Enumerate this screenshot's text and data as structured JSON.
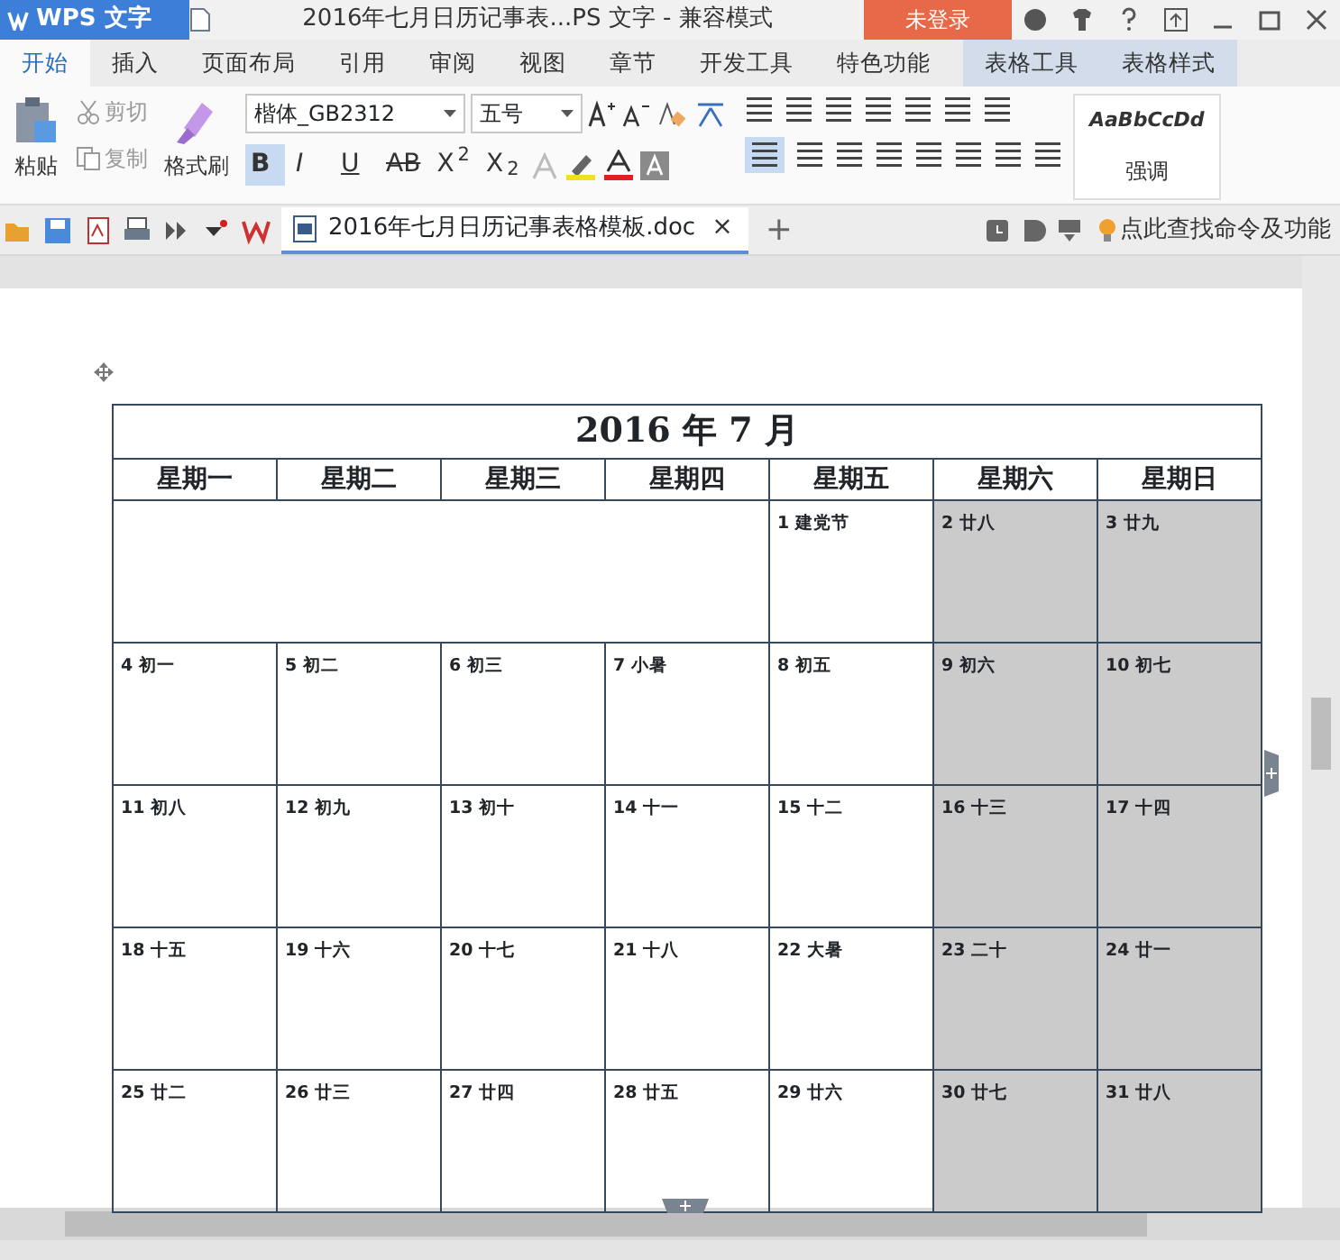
{
  "app_menu": {
    "label": "WPS 文字"
  },
  "window": {
    "title": "2016年七月日历记事表...PS 文字 - 兼容模式"
  },
  "login_button": {
    "label": "未登录"
  },
  "tabs": [
    {
      "label": "开始",
      "selected": true,
      "kind": "main"
    },
    {
      "label": "插入",
      "selected": false,
      "kind": "main"
    },
    {
      "label": "页面布局",
      "selected": false,
      "kind": "main"
    },
    {
      "label": "引用",
      "selected": false,
      "kind": "main"
    },
    {
      "label": "审阅",
      "selected": false,
      "kind": "main"
    },
    {
      "label": "视图",
      "selected": false,
      "kind": "main"
    },
    {
      "label": "章节",
      "selected": false,
      "kind": "main"
    },
    {
      "label": "开发工具",
      "selected": false,
      "kind": "main"
    },
    {
      "label": "特色功能",
      "selected": false,
      "kind": "main"
    },
    {
      "label": "表格工具",
      "selected": false,
      "kind": "context"
    },
    {
      "label": "表格样式",
      "selected": false,
      "kind": "context"
    }
  ],
  "ribbon": {
    "paste": "粘贴",
    "cut": "剪切",
    "copy": "复制",
    "format_painter": "格式刷",
    "font_name": "楷体_GB2312",
    "font_size": "五号",
    "format_buttons": [
      {
        "label": "B",
        "selected": true
      },
      {
        "label": "I",
        "selected": false
      },
      {
        "label": "U",
        "selected": false
      },
      {
        "label": "AB",
        "selected": false
      },
      {
        "label": "X$^{2}$",
        "selected": false
      },
      {
        "label": "X$_{2}$",
        "selected": false
      }
    ],
    "align_left_selected": true,
    "style_preview": "AaBbCcDd",
    "style_name": "强调"
  },
  "document_tab": {
    "label": "2016年七月日历记事表格模板.doc",
    "close": "×",
    "new": "+"
  },
  "command_search": {
    "label": "点此查找命令及功能"
  },
  "calendar": {
    "title": "2016 年 7 月",
    "weekdays": [
      "星期一",
      "星期二",
      "星期三",
      "星期四",
      "星期五",
      "星期六",
      "星期日"
    ],
    "weeks": [
      [
        {
          "kind": "blank"
        },
        {
          "kind": "blank"
        },
        {
          "kind": "blank"
        },
        {
          "kind": "blank"
        },
        {
          "kind": "day",
          "date": "1",
          "note": "建党节",
          "shaded": false
        },
        {
          "kind": "day",
          "date": "2",
          "note": "廿八",
          "shaded": true
        },
        {
          "kind": "day",
          "date": "3",
          "note": "廿九",
          "shaded": true
        }
      ],
      [
        {
          "kind": "day",
          "date": "4",
          "note": "初一",
          "shaded": false
        },
        {
          "kind": "day",
          "date": "5",
          "note": "初二",
          "shaded": false
        },
        {
          "kind": "day",
          "date": "6",
          "note": "初三",
          "shaded": false
        },
        {
          "kind": "day",
          "date": "7",
          "note": "小暑",
          "shaded": false
        },
        {
          "kind": "day",
          "date": "8",
          "note": "初五",
          "shaded": false
        },
        {
          "kind": "day",
          "date": "9",
          "note": "初六",
          "shaded": true
        },
        {
          "kind": "day",
          "date": "10",
          "note": "初七",
          "shaded": true
        }
      ],
      [
        {
          "kind": "day",
          "date": "11",
          "note": "初八",
          "shaded": false
        },
        {
          "kind": "day",
          "date": "12",
          "note": "初九",
          "shaded": false
        },
        {
          "kind": "day",
          "date": "13",
          "note": "初十",
          "shaded": false
        },
        {
          "kind": "day",
          "date": "14",
          "note": "十一",
          "shaded": false
        },
        {
          "kind": "day",
          "date": "15",
          "note": "十二",
          "shaded": false
        },
        {
          "kind": "day",
          "date": "16",
          "note": "十三",
          "shaded": true
        },
        {
          "kind": "day",
          "date": "17",
          "note": "十四",
          "shaded": true
        }
      ],
      [
        {
          "kind": "day",
          "date": "18",
          "note": "十五",
          "shaded": false
        },
        {
          "kind": "day",
          "date": "19",
          "note": "十六",
          "shaded": false
        },
        {
          "kind": "day",
          "date": "20",
          "note": "十七",
          "shaded": false
        },
        {
          "kind": "day",
          "date": "21",
          "note": "十八",
          "shaded": false
        },
        {
          "kind": "day",
          "date": "22",
          "note": "大暑",
          "shaded": false
        },
        {
          "kind": "day",
          "date": "23",
          "note": "二十",
          "shaded": true
        },
        {
          "kind": "day",
          "date": "24",
          "note": "廿一",
          "shaded": true
        }
      ],
      [
        {
          "kind": "day",
          "date": "25",
          "note": "廿二",
          "shaded": false
        },
        {
          "kind": "day",
          "date": "26",
          "note": "廿三",
          "shaded": false
        },
        {
          "kind": "day",
          "date": "27",
          "note": "廿四",
          "shaded": false
        },
        {
          "kind": "day",
          "date": "28",
          "note": "廿五",
          "shaded": false
        },
        {
          "kind": "day",
          "date": "29",
          "note": "廿六",
          "shaded": false
        },
        {
          "kind": "day",
          "date": "30",
          "note": "廿七",
          "shaded": true
        },
        {
          "kind": "day",
          "date": "31",
          "note": "廿八",
          "shaded": true
        }
      ]
    ]
  }
}
